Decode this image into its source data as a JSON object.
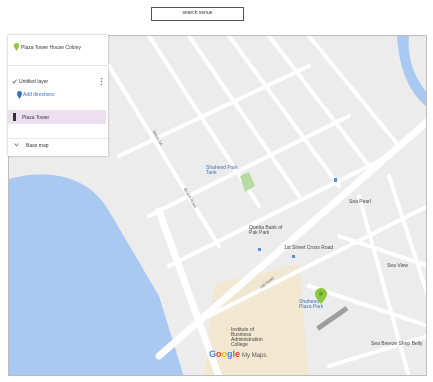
{
  "search": {
    "value": "search venue"
  },
  "panel": {
    "title": "Plaza Tower House Colony",
    "layer_name": "Untitled layer",
    "add_label": "Add directions",
    "item_label": "Plaza Tower",
    "base_map_label": "Base map"
  },
  "map": {
    "labels": {
      "park_name": "Shaheed Park Tank",
      "bank_name": "Quetta Bank of Pak Park",
      "street_main": "1st Street Cross Road",
      "street_a": "Street 1A",
      "street_b": "Beach Road",
      "street_c": "Hill Road",
      "place_right": "Sea Pearl",
      "place_far_right": "Sea View",
      "college_name": "Institute of Business Administration College",
      "target_name": "Shaheed Plaza Park",
      "bottom_right": "Sea Breeze Shop Belly"
    },
    "colors": {
      "water": "#a9c9f2",
      "land": "#ececec",
      "road": "#ffffff",
      "beige": "#f2e7d1",
      "park": "#b7dba0",
      "pin": "#8dc63f"
    }
  },
  "branding": {
    "google_letters": [
      "G",
      "o",
      "o",
      "g",
      "l",
      "e"
    ],
    "product": "My Maps"
  }
}
